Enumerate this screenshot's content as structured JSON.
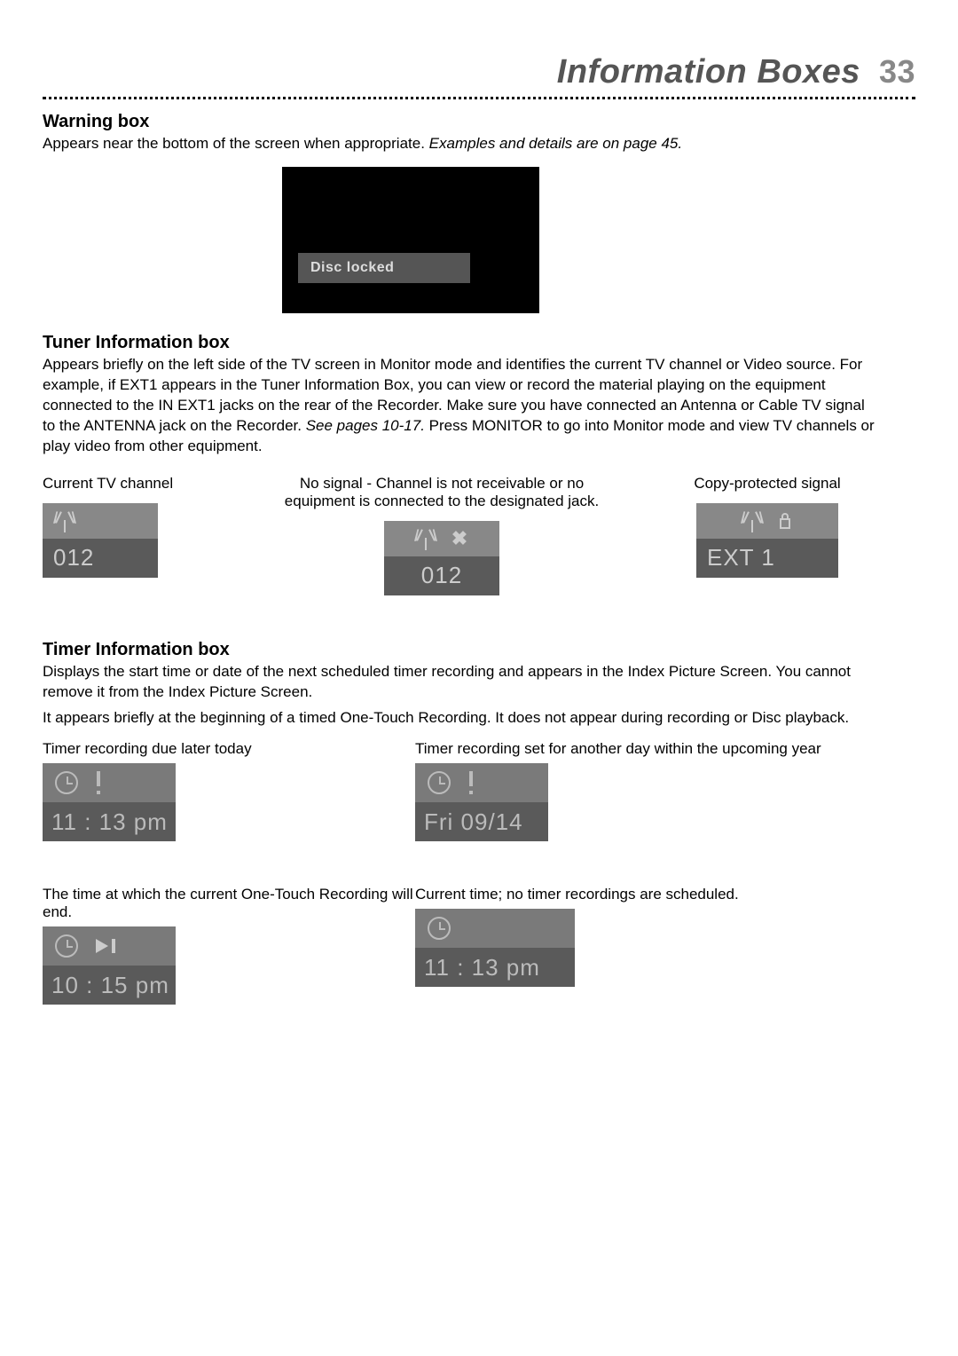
{
  "header": {
    "title": "Information Boxes",
    "page_number": "33"
  },
  "warning": {
    "heading": "Warning box",
    "desc": "Appears near the bottom of the screen when appropriate. ",
    "desc_italic": "Examples and details are on page 45.",
    "bar_text": "Disc locked"
  },
  "tuner": {
    "heading": "Tuner Information box",
    "p1": "Appears briefly on the left side of the TV screen in Monitor mode and identifies the current TV channel or Video source. For example, if EXT1 appears in the Tuner Information Box, you can view or record the material playing on the equipment connected to the IN EXT1 jacks on the rear of the Recorder. Make sure you have connected an Antenna or Cable TV signal to the ANTENNA jack on the Recorder. ",
    "p1_italic": "See pages 10-17.",
    "p1_tail": " Press MONITOR to go into Monitor mode and view TV channels or play video from other equipment.",
    "col_left_label": "Current TV channel",
    "col_mid_label": "No signal - Channel is not receivable or no equipment is connected to the designated jack.",
    "col_right_label": "Copy-protected signal",
    "box_left_value": "012",
    "box_mid_value": "012",
    "box_right_value": "EXT 1"
  },
  "timer": {
    "heading": "Timer Information box",
    "p1": "Displays the start time or date of the next scheduled timer recording and appears in the Index Picture Screen. You cannot remove it from the Index Picture Screen.",
    "p2": "It appears briefly at the beginning of a timed One-Touch Recording. It does not appear during recording or Disc playback.",
    "c1_label": "Timer recording due later today",
    "c1_value": "11 : 13 pm",
    "c2_label": "Timer recording set for another day within the upcoming year",
    "c2_value": "Fri 09/14",
    "c3_label": "The time at which the current One-Touch Recording will end.",
    "c3_value": "10 : 15 pm",
    "c4_label": "Current time; no timer recordings are scheduled.",
    "c4_value": "11 : 13 pm"
  }
}
